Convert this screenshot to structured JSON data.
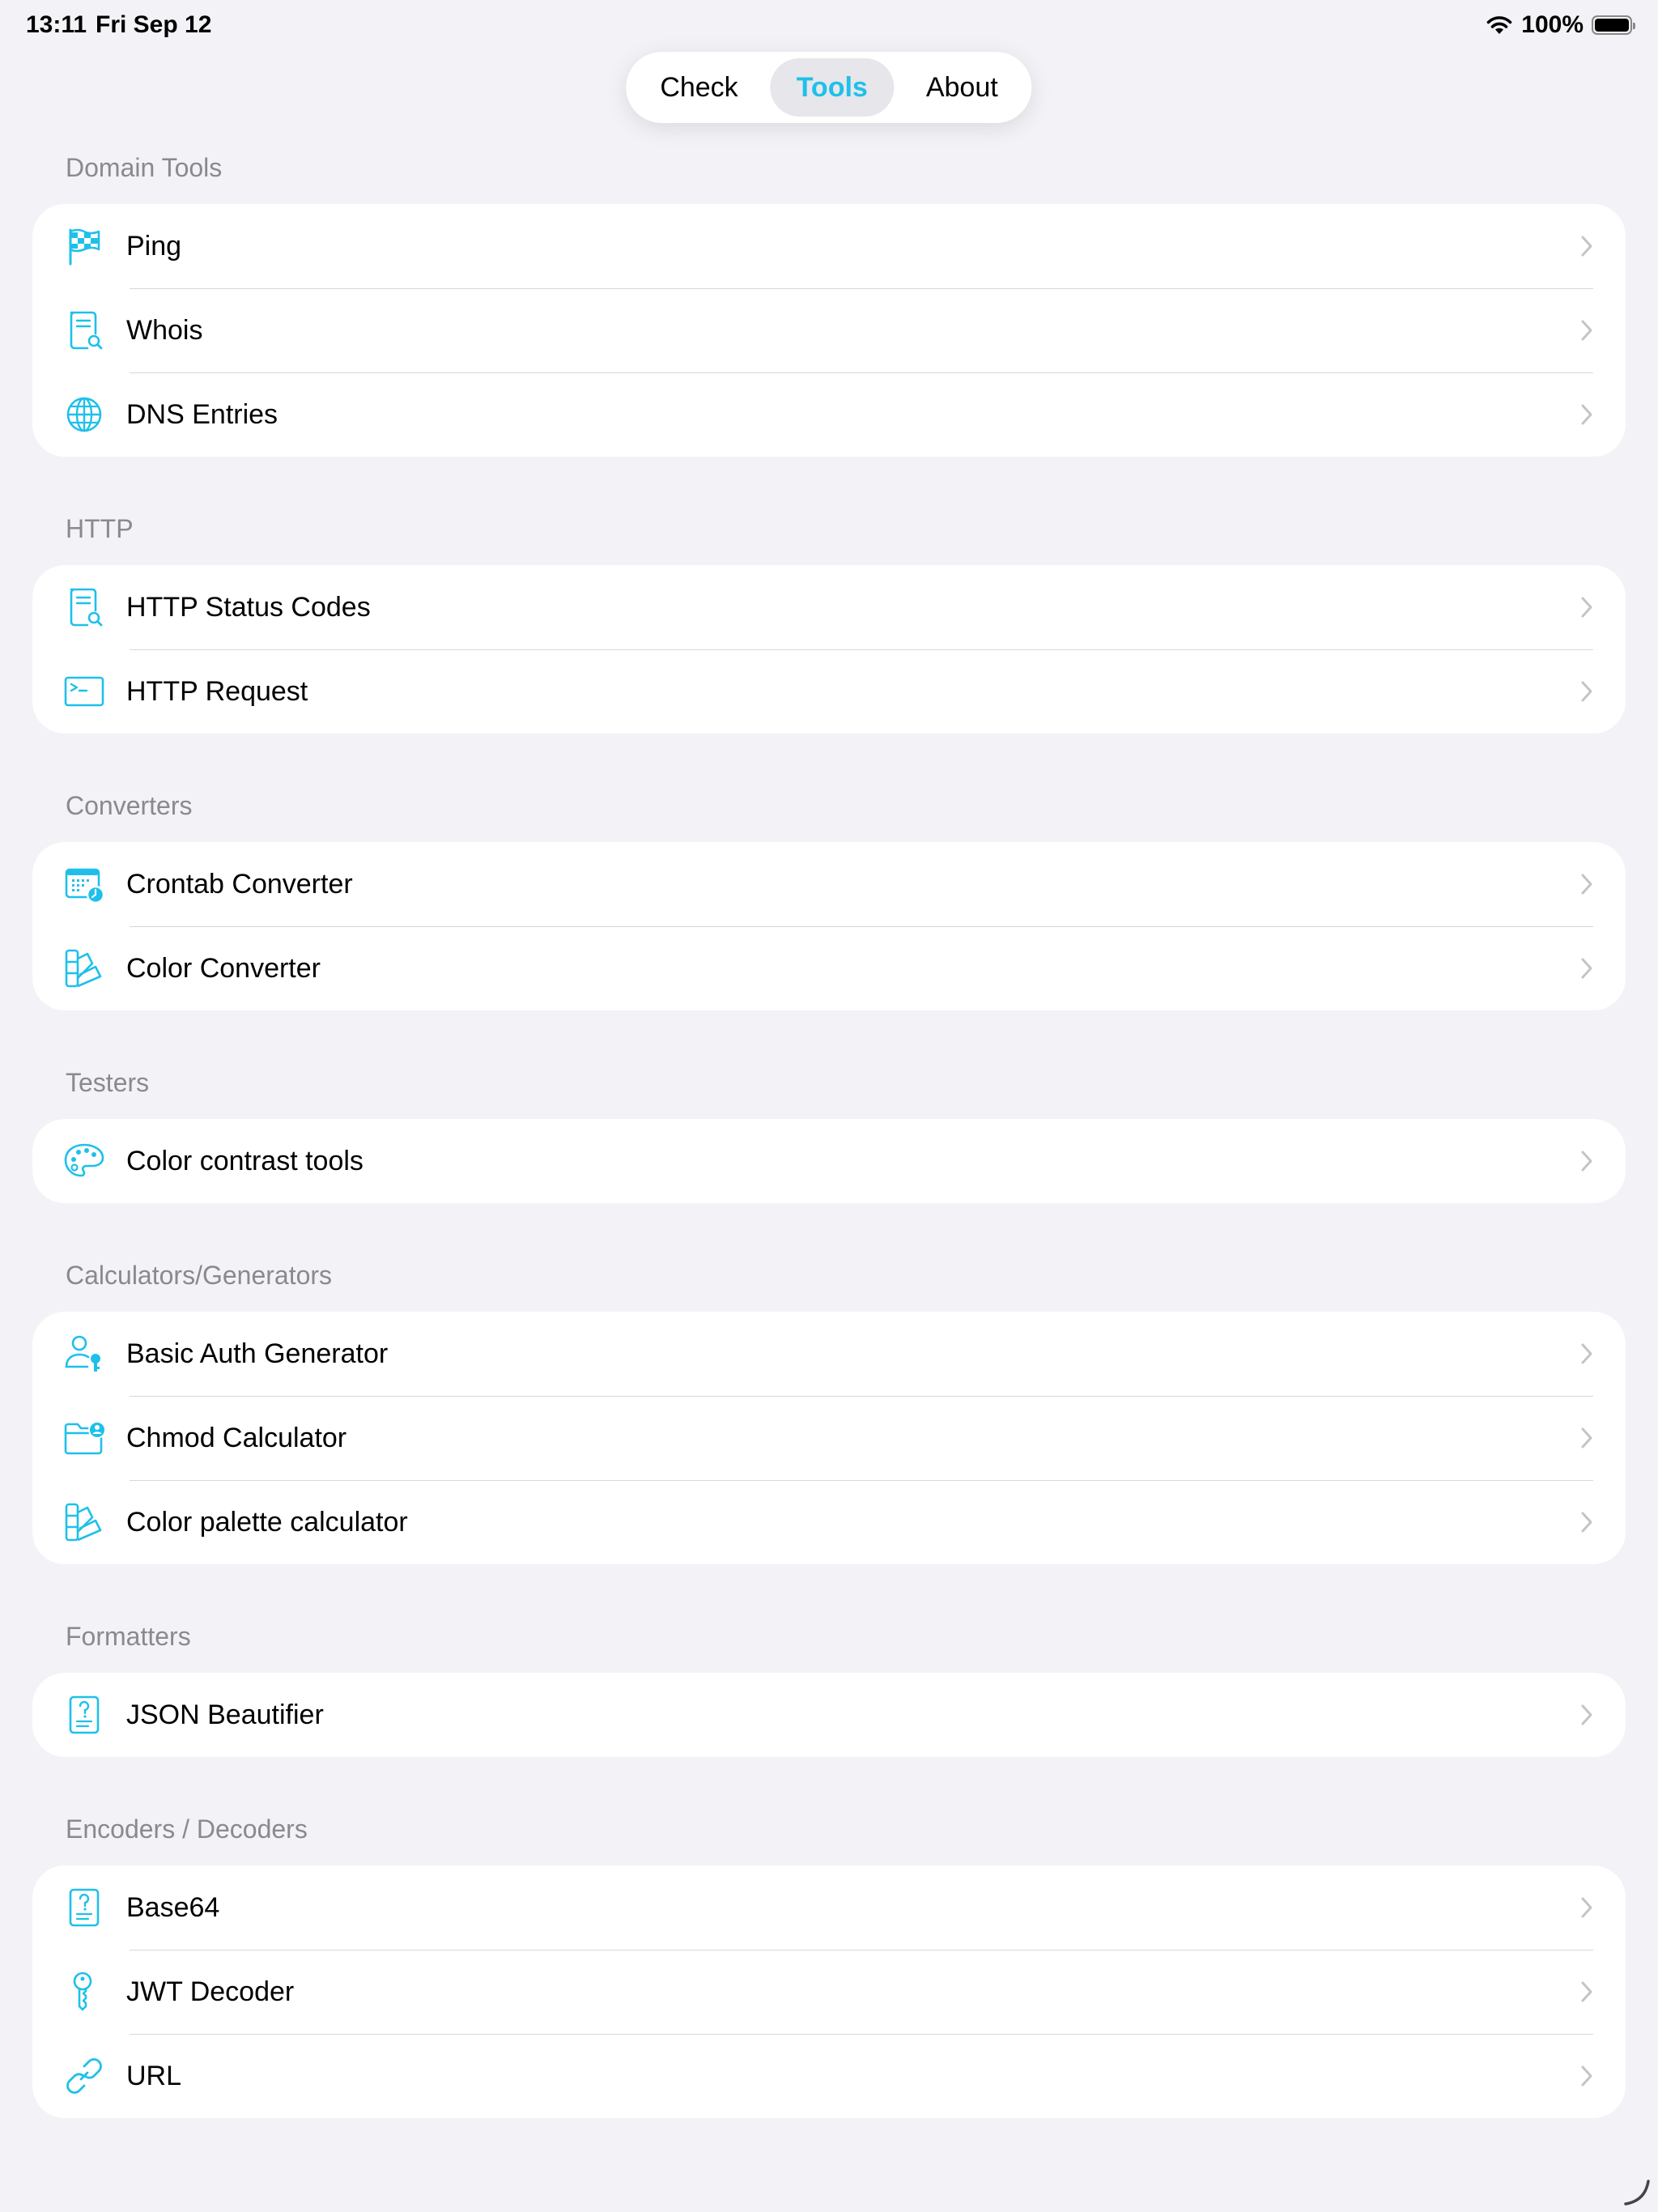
{
  "status_bar": {
    "time": "13:11",
    "date": "Fri Sep 12",
    "battery": "100%",
    "battery_level": 1.0
  },
  "tabs": [
    {
      "label": "Check",
      "active": false
    },
    {
      "label": "Tools",
      "active": true
    },
    {
      "label": "About",
      "active": false
    }
  ],
  "colors": {
    "accent": "#1ec0ea",
    "background": "#f2f2f7",
    "section_header": "#8a8a8e"
  },
  "sections": [
    {
      "header": "Domain Tools",
      "items": [
        {
          "label": "Ping",
          "icon": "flag-checkered-icon"
        },
        {
          "label": "Whois",
          "icon": "document-search-icon"
        },
        {
          "label": "DNS Entries",
          "icon": "globe-icon"
        }
      ]
    },
    {
      "header": "HTTP",
      "items": [
        {
          "label": "HTTP Status Codes",
          "icon": "document-search-icon"
        },
        {
          "label": "HTTP Request",
          "icon": "terminal-icon"
        }
      ]
    },
    {
      "header": "Converters",
      "items": [
        {
          "label": "Crontab Converter",
          "icon": "calendar-clock-icon"
        },
        {
          "label": "Color Converter",
          "icon": "swatchbook-icon"
        }
      ]
    },
    {
      "header": "Testers",
      "items": [
        {
          "label": "Color contrast tools",
          "icon": "palette-icon"
        }
      ]
    },
    {
      "header": "Calculators/Generators",
      "items": [
        {
          "label": "Basic Auth Generator",
          "icon": "person-key-icon"
        },
        {
          "label": "Chmod Calculator",
          "icon": "folder-person-icon"
        },
        {
          "label": "Color palette calculator",
          "icon": "swatchbook-icon"
        }
      ]
    },
    {
      "header": "Formatters",
      "items": [
        {
          "label": "JSON Beautifier",
          "icon": "document-question-icon"
        }
      ]
    },
    {
      "header": "Encoders / Decoders",
      "items": [
        {
          "label": "Base64",
          "icon": "document-question-icon"
        },
        {
          "label": "JWT Decoder",
          "icon": "key-icon"
        },
        {
          "label": "URL",
          "icon": "link-icon"
        }
      ]
    }
  ]
}
